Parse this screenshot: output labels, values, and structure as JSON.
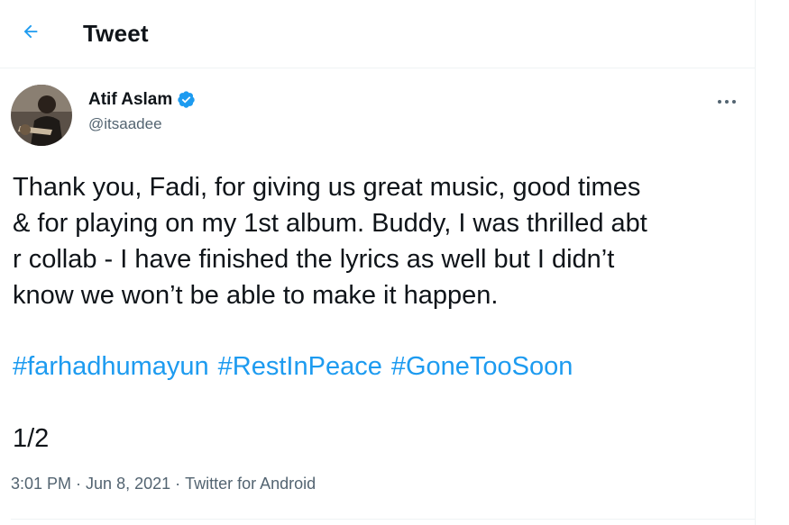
{
  "header": {
    "title": "Tweet",
    "back_icon": "arrow-left-icon",
    "accent_color": "#1d9bf0"
  },
  "author": {
    "display_name": "Atif Aslam",
    "handle": "@itsaadee",
    "verified": true,
    "verified_icon": "verified-badge-icon",
    "more_icon": "more-dots-icon"
  },
  "tweet": {
    "text": "Thank you, Fadi, for giving us great music, good times\n& for playing on my 1st album. Buddy, I was thrilled abt\nr collab - I have finished the lyrics as well but I didn’t\nknow we won’t be able to make it happen.",
    "hashtags": [
      "#farhadhumayun",
      "#RestInPeace",
      "#GoneTooSoon"
    ],
    "counter": "1/2",
    "time": "3:01 PM",
    "date": "Jun 8, 2021",
    "separator": "·",
    "source": "Twitter for Android"
  },
  "colors": {
    "text": "#0f1419",
    "muted": "#536471",
    "link": "#1d9bf0",
    "divider": "#eff3f4"
  }
}
